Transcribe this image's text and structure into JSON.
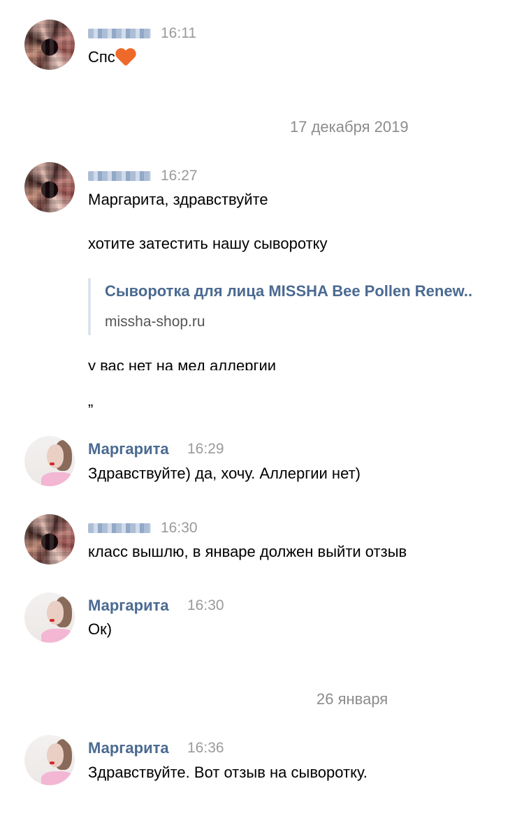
{
  "messages": [
    {
      "author": "",
      "time": "16:11",
      "text": "Спс"
    },
    {
      "author": "",
      "time": "16:27",
      "lines": [
        "Маргарита, здравствуйте",
        "хотите затестить нашу сыворотку"
      ]
    },
    {
      "author": "Маргарита",
      "time": "16:29",
      "text": "Здравствуйте) да, хочу. Аллергии нет)"
    },
    {
      "author": "",
      "time": "16:30",
      "text": "класс вышлю, в январе должен выйти отзыв"
    },
    {
      "author": "Маргарита",
      "time": "16:30",
      "text": "Ок)"
    },
    {
      "author": "Маргарита",
      "time": "16:36",
      "text": "Здравствуйте. Вот отзыв на сыворотку."
    }
  ],
  "link_preview": {
    "title": "Сыворотка для лица MISSHA Bee Pollen Renew..",
    "domain": "missha-shop.ru"
  },
  "clipped_line": "у вас нет на мед аллергии",
  "stray_mark": "„",
  "date_separators": [
    "17 декабря 2019",
    "26 января"
  ],
  "icons": {
    "heart": "orange-heart-emoji"
  },
  "colors": {
    "author_name": "#4a6a91",
    "time": "#9a9a9a",
    "heart": "#ef6a2a",
    "shirt": "#f3b6d3"
  }
}
